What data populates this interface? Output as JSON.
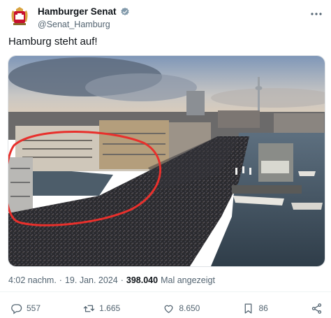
{
  "author": {
    "name": "Hamburger Senat",
    "handle": "@Senat_Hamburg",
    "verified_icon": "verified-badge-icon"
  },
  "more_icon": "more-dots-icon",
  "tweet": {
    "text": "Hamburg steht auf!"
  },
  "meta": {
    "time": "4:02 nachm.",
    "separator": "·",
    "date": "19. Jan. 2024",
    "views_count": "398.040",
    "views_label": "Mal angezeigt"
  },
  "actions": {
    "replies": "557",
    "reposts": "1.665",
    "likes": "8.650",
    "bookmarks": "86"
  },
  "colors": {
    "text": "#0f1419",
    "secondary": "#536471",
    "verified": "#829aab",
    "annotation_circle": "#e8302c"
  }
}
